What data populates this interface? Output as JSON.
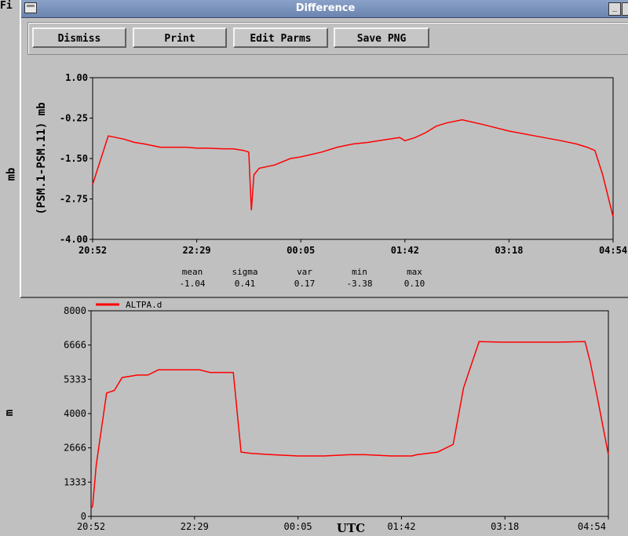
{
  "background_app": {
    "menu_label": "Fi",
    "top_ylabel": "mb",
    "altitude_chart": {
      "legend": "ALTPA.d",
      "ylabel": "m",
      "xlabel": "UTC",
      "y_ticks": [
        "8000",
        "6666",
        "5333",
        "4000",
        "2666",
        "1333",
        "0"
      ],
      "x_ticks": [
        "20:52",
        "22:29",
        "00:05",
        "01:42",
        "03:18",
        "04:54"
      ]
    }
  },
  "dialog": {
    "title": "Difference",
    "buttons": {
      "dismiss": "Dismiss",
      "print": "Print",
      "edit_parms": "Edit Parms",
      "save_png": "Save PNG"
    },
    "stats": {
      "labels": {
        "mean": "mean",
        "sigma": "sigma",
        "var": "var",
        "min": "min",
        "max": "max"
      },
      "values": {
        "mean": "-1.04",
        "sigma": "0.41",
        "var": "0.17",
        "min": "-3.38",
        "max": "0.10"
      }
    }
  },
  "colors": {
    "series": "#ff0000",
    "window_bg": "#c0c0c0",
    "titlebar": "#7890bc"
  },
  "chart_data": [
    {
      "type": "line",
      "ylabel": "(PSM.1-PSM.11) mb",
      "ylim": [
        -4.0,
        1.0
      ],
      "y_ticks": [
        "1.00",
        "-0.25",
        "-1.50",
        "-2.75",
        "-4.00"
      ],
      "x_ticks": [
        "20:52",
        "22:29",
        "00:05",
        "01:42",
        "03:18",
        "04:54"
      ],
      "series": [
        {
          "x": [
            0,
            0.03,
            0.06,
            0.08,
            0.1,
            0.13,
            0.15,
            0.18,
            0.2,
            0.22,
            0.25,
            0.27,
            0.29,
            0.3,
            0.305,
            0.31,
            0.32,
            0.35,
            0.38,
            0.4,
            0.44,
            0.47,
            0.5,
            0.53,
            0.55,
            0.57,
            0.59,
            0.6,
            0.62,
            0.64,
            0.66,
            0.68,
            0.71,
            0.75,
            0.8,
            0.85,
            0.9,
            0.93,
            0.95,
            0.965,
            0.98,
            1.0
          ],
          "y": [
            -2.3,
            -0.8,
            -0.9,
            -1.0,
            -1.05,
            -1.15,
            -1.15,
            -1.15,
            -1.18,
            -1.18,
            -1.2,
            -1.2,
            -1.25,
            -1.3,
            -3.1,
            -2.0,
            -1.8,
            -1.7,
            -1.5,
            -1.45,
            -1.3,
            -1.15,
            -1.05,
            -1.0,
            -0.95,
            -0.9,
            -0.85,
            -0.95,
            -0.85,
            -0.7,
            -0.5,
            -0.4,
            -0.3,
            -0.45,
            -0.65,
            -0.8,
            -0.95,
            -1.05,
            -1.15,
            -1.25,
            -2.0,
            -3.3
          ]
        }
      ]
    },
    {
      "type": "line",
      "series_name": "ALTPA.d",
      "ylim": [
        0,
        8000
      ],
      "x": [
        0,
        0.003,
        0.01,
        0.02,
        0.03,
        0.045,
        0.06,
        0.09,
        0.11,
        0.13,
        0.17,
        0.21,
        0.23,
        0.27,
        0.275,
        0.29,
        0.31,
        0.35,
        0.4,
        0.45,
        0.5,
        0.53,
        0.58,
        0.62,
        0.63,
        0.65,
        0.67,
        0.7,
        0.72,
        0.75,
        0.8,
        0.85,
        0.9,
        0.955,
        0.965,
        0.98,
        1.0
      ],
      "y": [
        300,
        400,
        2000,
        3400,
        4800,
        4900,
        5400,
        5500,
        5500,
        5700,
        5700,
        5700,
        5600,
        5600,
        5600,
        2500,
        2450,
        2400,
        2350,
        2350,
        2400,
        2400,
        2350,
        2350,
        2400,
        2450,
        2500,
        2800,
        5000,
        6800,
        6780,
        6780,
        6780,
        6800,
        6000,
        4500,
        2400
      ]
    }
  ]
}
